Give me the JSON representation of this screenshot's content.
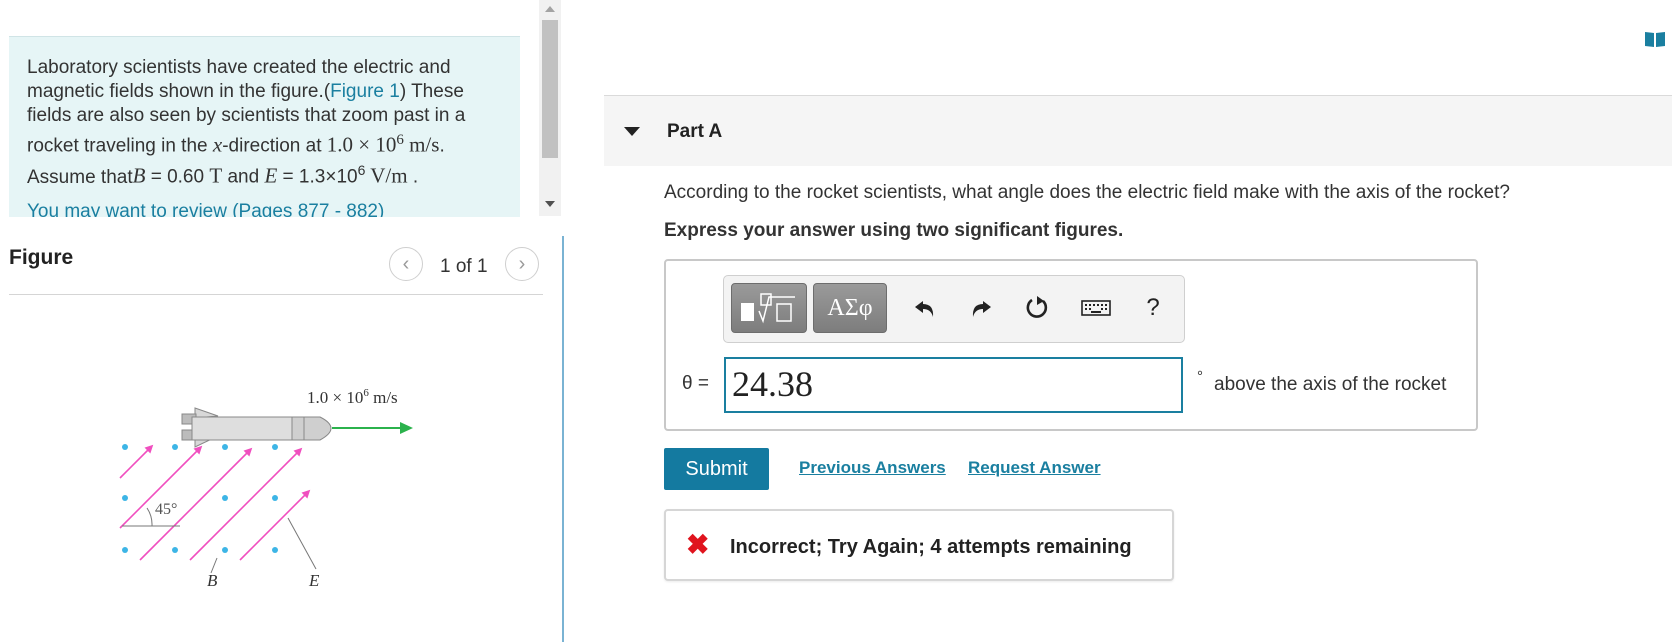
{
  "problem": {
    "text_intro": "Laboratory scientists have created the electric and magnetic fields shown in the figure.(",
    "figure_link": "Figure 1",
    "text_mid": ") These fields are also seen by scientists that zoom past in a rocket traveling in the ",
    "x_var": "x",
    "text_dir": "-direction at ",
    "speed_value": "1.0 × 10",
    "speed_exp": "6",
    "speed_unit": " m/s",
    "text_period": ".",
    "assume_prefix": "Assume that ",
    "b_var": "B",
    "b_equals": " = 0.60 ",
    "b_unit": "T",
    "and_word": " and ",
    "e_var": "E",
    "e_equals": " = 1.3×10",
    "e_exp": "6",
    "e_unit": " V/m",
    "end_period": " .",
    "review_line": "You may want to review (Pages 877 - 882)"
  },
  "figure": {
    "title": "Figure",
    "pager": "1 of 1",
    "speed_label_value": "1.0 × 10",
    "speed_label_exp": "6",
    "speed_label_unit": " m/s",
    "angle_label": "45°",
    "b_label": "B",
    "e_label": "E"
  },
  "part": {
    "title": "Part A",
    "question": "According to the rocket scientists, what angle does the electric field make with the axis of the rocket?",
    "instruction": "Express your answer using two significant figures."
  },
  "toolbar": {
    "greek_label": "ΑΣφ",
    "help_label": "?",
    "icons": [
      "templates-icon",
      "greek-symbols-icon",
      "undo-icon",
      "redo-icon",
      "reset-icon",
      "keyboard-icon",
      "help-icon"
    ]
  },
  "answer": {
    "variable_label": "θ =",
    "value": "24.38",
    "degree": "°",
    "units": "above the axis of the rocket"
  },
  "actions": {
    "submit": "Submit",
    "previous_answers": "Previous Answers",
    "request_answer": "Request Answer"
  },
  "feedback": {
    "status_text": "Incorrect; Try Again; 4 attempts remaining"
  },
  "colors": {
    "accent": "#147aa0",
    "link": "#1a7fa0",
    "error": "#e0141e",
    "problem_bg": "#e6f5f6",
    "field_b": "#3db5e6",
    "field_e": "#f04fbf",
    "velocity_arrow": "#2bb24c"
  }
}
